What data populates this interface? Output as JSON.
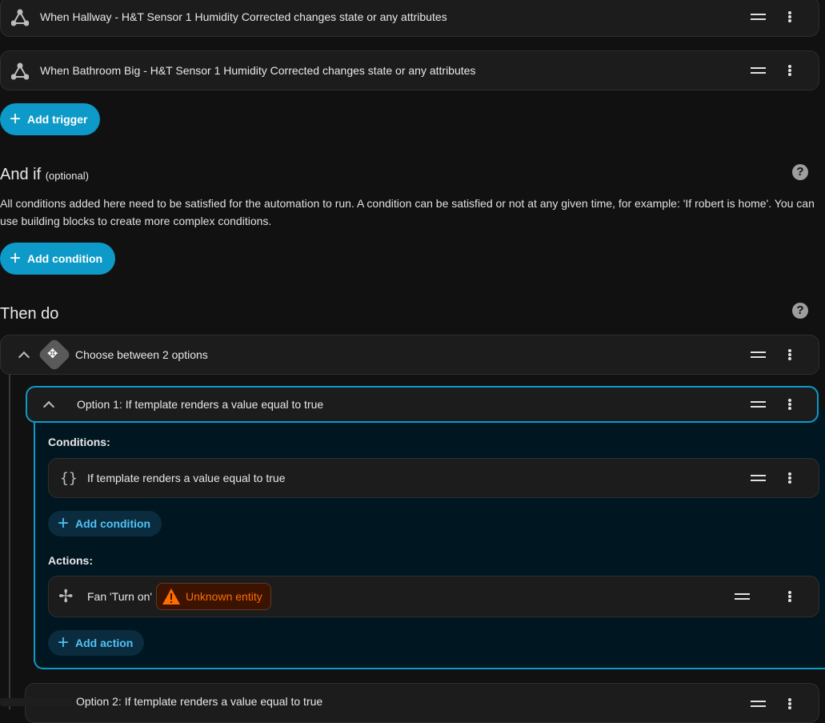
{
  "triggers": [
    {
      "label": "When Hallway - H&T Sensor 1 Humidity Corrected changes state or any attributes",
      "icon": "state-trigger-icon"
    },
    {
      "label": "When Bathroom Big - H&T Sensor 1 Humidity Corrected changes state or any attributes",
      "icon": "state-trigger-icon"
    }
  ],
  "add_trigger": "Add trigger",
  "conditions_section": {
    "title": "And if",
    "optional": "(optional)",
    "description": "All conditions added here need to be satisfied for the automation to run. A condition can be satisfied or not at any given time, for example: 'If robert is home'. You can use building blocks to create more complex conditions.",
    "add_condition": "Add condition"
  },
  "actions_section": {
    "title": "Then do",
    "choose": {
      "label": "Choose between 2 options"
    },
    "option1": {
      "label": "Option 1: If template renders a value equal to true",
      "conditions_label": "Conditions:",
      "condition": "If template renders a value equal to true",
      "condition_icon": "{}",
      "add_condition": "Add condition",
      "actions_label": "Actions:",
      "action": "Fan 'Turn on'",
      "warning": "Unknown entity",
      "add_action": "Add action"
    },
    "option2": {
      "label": "Option 2: If template renders a value equal to true"
    }
  },
  "colors": {
    "accent": "#0d9ac8",
    "warning": "#ff6d00"
  }
}
